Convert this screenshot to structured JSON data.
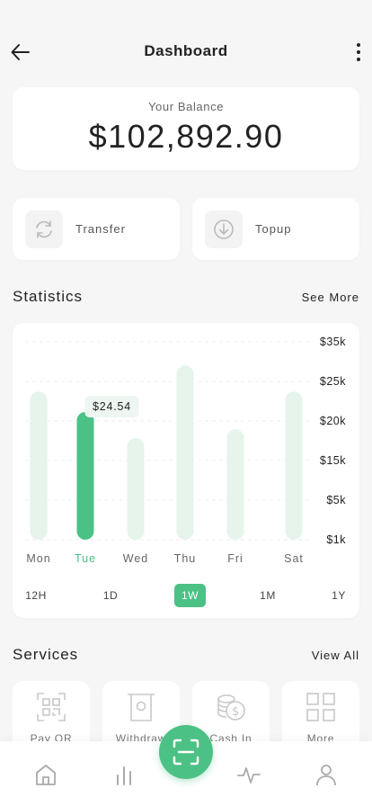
{
  "header": {
    "title": "Dashboard"
  },
  "balance": {
    "label": "Your Balance",
    "value": "$102,892.90"
  },
  "actions": [
    {
      "label": "Transfer",
      "icon": "refresh-icon"
    },
    {
      "label": "Topup",
      "icon": "download-icon"
    }
  ],
  "statistics": {
    "title": "Statistics",
    "link": "See More"
  },
  "chart_data": {
    "type": "bar",
    "categories": [
      "Mon",
      "Tue",
      "Wed",
      "Thu",
      "Fri",
      "Sat"
    ],
    "values": [
      25500,
      22000,
      17500,
      30000,
      19000,
      25500
    ],
    "highlight_index": 1,
    "highlight_label": "$24.54",
    "y_ticks": [
      "$35k",
      "$25k",
      "$20k",
      "$15k",
      "$5k",
      "$1k"
    ],
    "grid": true,
    "colors": {
      "bar": "#e6f4eb",
      "highlight": "#4cc185",
      "highlight_text": "#4cc185",
      "tooltip_bg": "#eef6f1"
    }
  },
  "periods": {
    "items": [
      "12H",
      "1D",
      "1W",
      "1M",
      "1Y"
    ],
    "active": "1W"
  },
  "services": {
    "title": "Services",
    "link": "View All",
    "items": [
      {
        "label": "Pay QR",
        "icon": "qr-code-icon"
      },
      {
        "label": "Withdraw",
        "icon": "withdraw-icon"
      },
      {
        "label": "Cash In",
        "icon": "coins-icon"
      },
      {
        "label": "More",
        "icon": "grid-icon"
      }
    ]
  },
  "nav": {
    "items": [
      {
        "name": "home-icon"
      },
      {
        "name": "stats-icon"
      },
      {
        "name": "activity-icon"
      },
      {
        "name": "profile-icon"
      }
    ],
    "center": "scan-icon"
  },
  "colors": {
    "accent": "#4cc185",
    "background": "#f6f6f6",
    "card": "#ffffff"
  }
}
